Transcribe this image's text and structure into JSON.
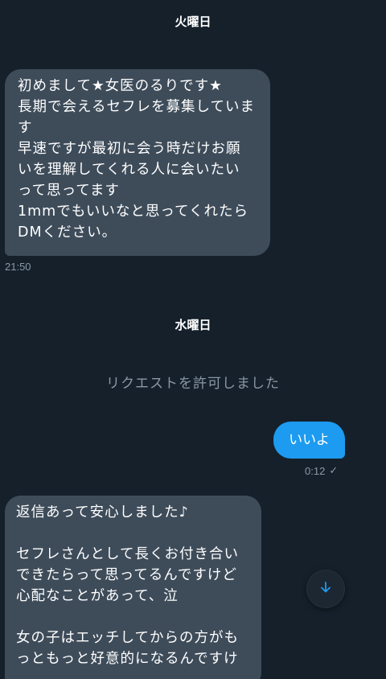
{
  "dates": {
    "first": "火曜日",
    "second": "水曜日"
  },
  "messages": {
    "incoming_1": "初めまして★女医のるりです★\n長期で会えるセフレを募集していま\nす\n早速ですが最初に会う時だけお願\nいを理解してくれる人に会いたい\nって思ってます\n1mmでもいいなと思ってくれたら\nDMください。",
    "incoming_1_time": "21:50",
    "system": "リクエストを許可しました",
    "outgoing_1": "いいよ",
    "outgoing_1_time": "0:12",
    "outgoing_1_status": "✓",
    "incoming_2": "返信あって安心しました♪\n\nセフレさんとして長くお付き合い\nできたらって思ってるんですけど\n心配なことがあって、泣\n\n女の子はエッチしてからの方がも\nっともっと好意的になるんですけ"
  },
  "colors": {
    "background": "#15202b",
    "incoming_bubble": "#3e4c5a",
    "outgoing_bubble": "#1d9bf0",
    "muted_text": "#8b98a5"
  },
  "icons": {
    "scroll_down": "arrow-down-icon"
  }
}
